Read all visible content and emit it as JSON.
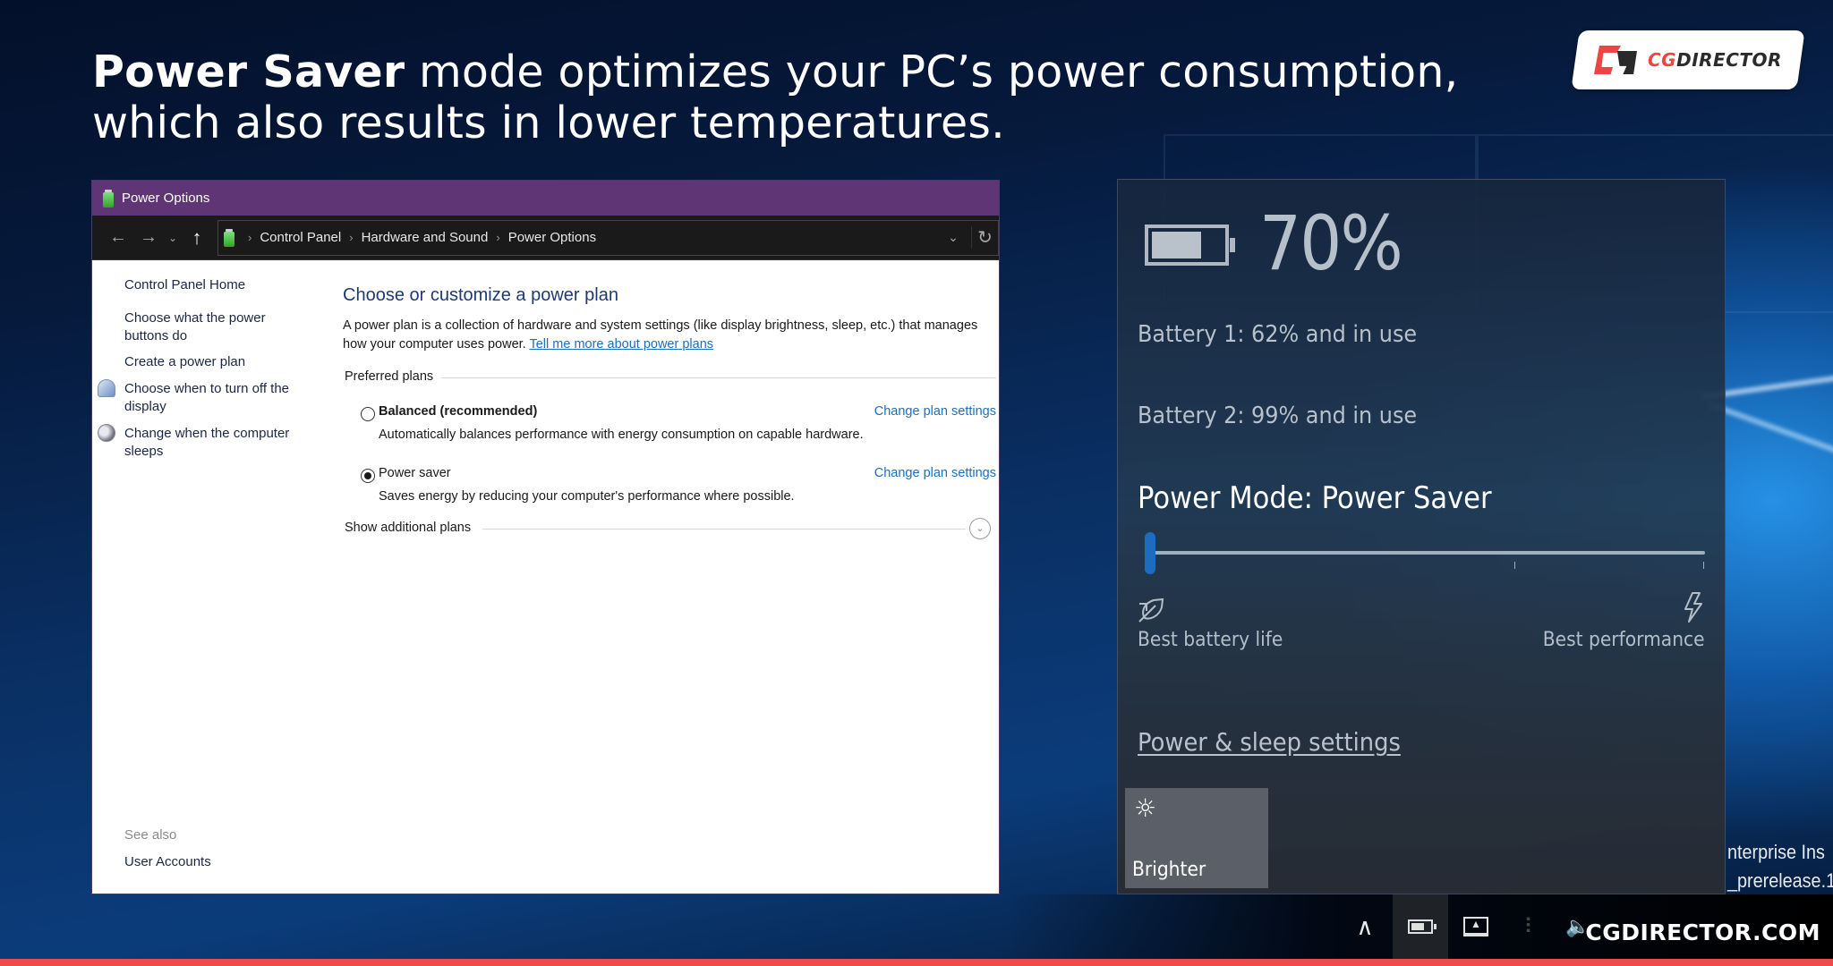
{
  "headline": {
    "bold": "Power Saver",
    "line1_rest": " mode optimizes your PC’s power consumption,",
    "line2": "which also results in lower temperatures."
  },
  "logo": {
    "prefix": "CG",
    "suffix": "DIRECTOR"
  },
  "window": {
    "title": "Power Options",
    "nav": {
      "back_icon": "←",
      "forward_icon": "→",
      "recent_icon": "⌄",
      "up_icon": "↑",
      "dropdown_icon": "⌄",
      "refresh_icon": "↻"
    },
    "breadcrumb": [
      "Control Panel",
      "Hardware and Sound",
      "Power Options"
    ],
    "breadcrumb_sep": "›",
    "sidebar": {
      "home": "Control Panel Home",
      "links": [
        "Choose what the power buttons do",
        "Create a power plan",
        "Choose when to turn off the display",
        "Change when the computer sleeps"
      ],
      "see_also_label": "See also",
      "see_also_links": [
        "User Accounts"
      ]
    },
    "main": {
      "heading": "Choose or customize a power plan",
      "description": "A power plan is a collection of hardware and system settings (like display brightness, sleep, etc.) that manages how your computer uses power. ",
      "learn_more_link": "Tell me more about power plans",
      "group_label": "Preferred plans",
      "plans": [
        {
          "name": "Balanced (recommended)",
          "description": "Automatically balances performance with energy consumption on capable hardware.",
          "selected": false,
          "change_link": "Change plan settings"
        },
        {
          "name": "Power saver",
          "description": "Saves energy by reducing your computer's performance where possible.",
          "selected": true,
          "change_link": "Change plan settings"
        }
      ],
      "show_additional": "Show additional plans",
      "expand_icon": "⌄"
    }
  },
  "flyout": {
    "battery_percent": "70%",
    "battery_level": 0.7,
    "batteries": [
      "Battery 1: 62% and in use",
      "Battery 2: 99% and in use"
    ],
    "power_mode_title": "Power Mode: Power Saver",
    "slider": {
      "position": 0,
      "stops": 3,
      "left_label": "Best battery life",
      "right_label": "Best performance",
      "accent": "#1c6dc0"
    },
    "settings_link": "Power & sleep settings",
    "quick_action": {
      "label": "Brighter",
      "icon": "☼"
    }
  },
  "watermark": {
    "line1": "nterprise Ins",
    "line2": "_prerelease.1"
  },
  "taskbar": {
    "chevron_icon": "∧",
    "site": "CGDIRECTOR.COM",
    "stripe_color": "#f04a4a"
  }
}
